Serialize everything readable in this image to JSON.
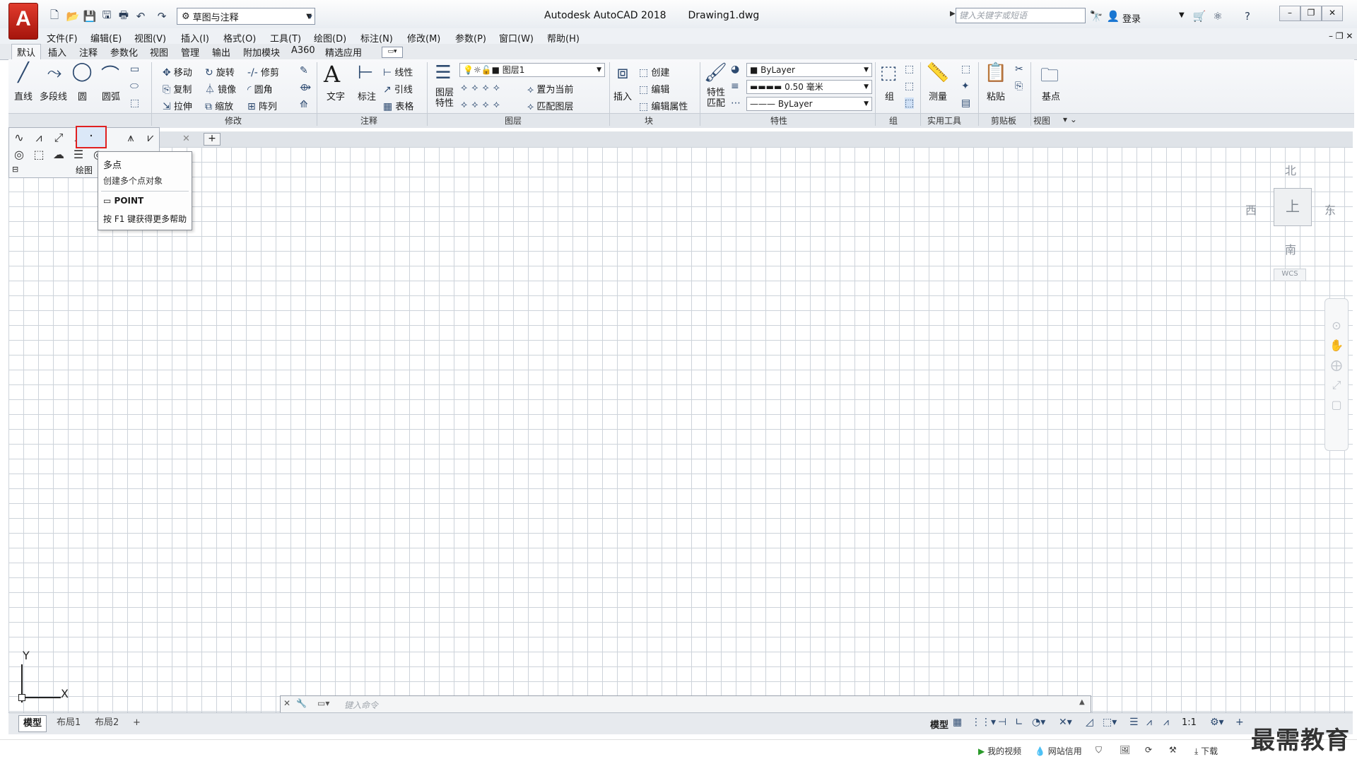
{
  "titlebar": {
    "workspace": "草图与注释",
    "app_title": "Autodesk AutoCAD 2018",
    "file_name": "Drawing1.dwg",
    "search_placeholder": "键入关键字或短语",
    "login_label": "登录"
  },
  "menubar": [
    "文件(F)",
    "编辑(E)",
    "视图(V)",
    "插入(I)",
    "格式(O)",
    "工具(T)",
    "绘图(D)",
    "标注(N)",
    "修改(M)",
    "参数(P)",
    "窗口(W)",
    "帮助(H)"
  ],
  "ribbon_tabs": [
    "默认",
    "插入",
    "注释",
    "参数化",
    "视图",
    "管理",
    "输出",
    "附加模块",
    "A360",
    "精选应用"
  ],
  "draw_panel": {
    "line": "直线",
    "polyline": "多段线",
    "circle": "圆",
    "arc": "圆弧",
    "title": "绘图"
  },
  "modify_panel": {
    "title": "修改",
    "items": [
      "移动",
      "旋转",
      "修剪",
      "复制",
      "镜像",
      "圆角",
      "拉伸",
      "缩放",
      "阵列"
    ]
  },
  "annotate_panel": {
    "title": "注释",
    "text": "文字",
    "dim": "标注",
    "linear": "线性",
    "leader": "引线",
    "table": "表格"
  },
  "layers_panel": {
    "title": "图层",
    "props": "图层特性",
    "layer_name": "图层1",
    "set_current": "置为当前",
    "match_layer": "匹配图层"
  },
  "block_panel": {
    "title": "块",
    "insert": "插入",
    "create": "创建",
    "edit": "编辑",
    "edit_attr": "编辑属性"
  },
  "properties_panel": {
    "title": "特性",
    "match": "特性匹配",
    "color": "ByLayer",
    "lineweight": "0.50 毫米",
    "linetype": "ByLayer"
  },
  "groups_panel": {
    "title": "组",
    "group": "组"
  },
  "utilities_panel": {
    "title": "实用工具",
    "measure": "测量"
  },
  "clipboard_panel": {
    "title": "剪贴板",
    "paste": "粘贴"
  },
  "view_panel": {
    "title": "视图",
    "base": "基点"
  },
  "tooltip": {
    "title": "多点",
    "description": "创建多个点对象",
    "command": "POINT",
    "help": "按 F1 键获得更多帮助"
  },
  "viewcube": {
    "north": "北",
    "south": "南",
    "east": "东",
    "west": "西",
    "top": "上",
    "wcs": "WCS"
  },
  "ucs": {
    "y": "Y",
    "x": "X"
  },
  "command_line": {
    "placeholder": "键入命令"
  },
  "layout_tabs": [
    "模型",
    "布局1",
    "布局2"
  ],
  "status": {
    "model": "模型",
    "scale": "1:1"
  },
  "taskbar": {
    "my_video": "我的视频",
    "net_credit": "网站信用",
    "download": "下载"
  },
  "watermark": "最需教育",
  "colors": {
    "logo_red": "#c9261a",
    "selection_border": "#e02020",
    "grid": "#cdd3da"
  }
}
